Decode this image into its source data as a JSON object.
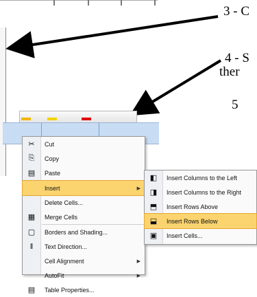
{
  "annotations": {
    "step3": "3 - C",
    "step4": "4 - S",
    "step4_line2": "ther",
    "step5": "5"
  },
  "context_menu": {
    "items": [
      {
        "label": "Cut",
        "icon": "scissors-icon",
        "glyph": "✂"
      },
      {
        "label": "Copy",
        "icon": "copy-icon",
        "glyph": "⎘"
      },
      {
        "label": "Paste",
        "icon": "paste-icon",
        "glyph": "📋"
      },
      {
        "label": "Insert",
        "icon": "",
        "highlighted": true,
        "submenu": true
      },
      {
        "label": "Delete Cells...",
        "icon": ""
      },
      {
        "label": "Merge Cells",
        "icon": "merge-cells-icon",
        "glyph": "▦"
      },
      {
        "label": "Borders and Shading...",
        "icon": "borders-icon",
        "glyph": "▢"
      },
      {
        "label": "Text Direction...",
        "icon": "text-direction-icon",
        "glyph": "‖A"
      },
      {
        "label": "Cell Alignment",
        "icon": "",
        "submenu": true
      },
      {
        "label": "AutoFit",
        "icon": "",
        "submenu": true
      },
      {
        "label": "Table Properties...",
        "icon": "table-properties-icon",
        "glyph": "▤"
      }
    ]
  },
  "insert_submenu": {
    "items": [
      {
        "label": "Insert Columns to the Left",
        "icon": "insert-columns-left-icon",
        "glyph": "◧"
      },
      {
        "label": "Insert Columns to the Right",
        "icon": "insert-columns-right-icon",
        "glyph": "◨"
      },
      {
        "label": "Insert Rows Above",
        "icon": "insert-rows-above-icon",
        "glyph": "⬒"
      },
      {
        "label": "Insert Rows Below",
        "icon": "insert-rows-below-icon",
        "glyph": "⬓",
        "highlighted": true
      },
      {
        "label": "Insert Cells...",
        "icon": "insert-cells-icon",
        "glyph": "▣"
      }
    ]
  }
}
